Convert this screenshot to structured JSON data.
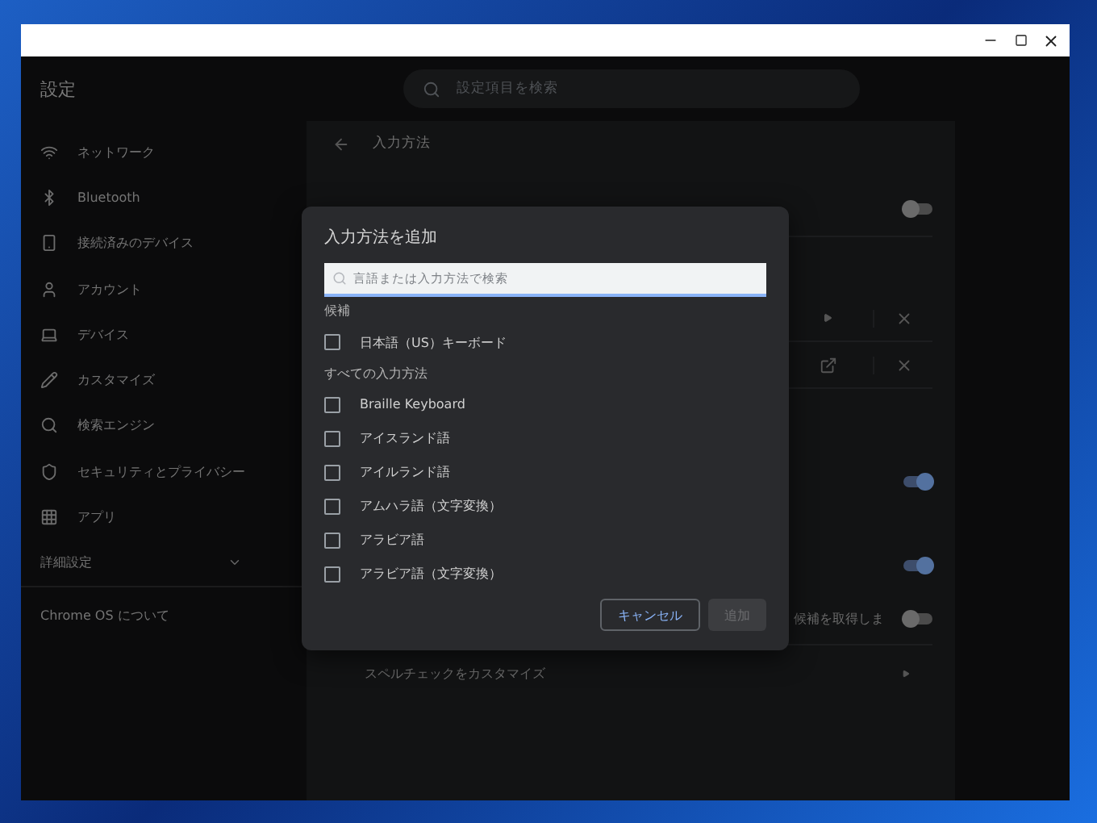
{
  "app": {
    "title": "設定",
    "search": {
      "placeholder": "設定項目を検索"
    }
  },
  "sidebar": {
    "items": [
      {
        "label": "ネットワーク"
      },
      {
        "label": "Bluetooth"
      },
      {
        "label": "接続済みのデバイス"
      },
      {
        "label": "アカウント"
      },
      {
        "label": "デバイス"
      },
      {
        "label": "カスタマイズ"
      },
      {
        "label": "検索エンジン"
      },
      {
        "label": "セキュリティとプライバシー"
      },
      {
        "label": "アプリ"
      }
    ],
    "advanced": {
      "label": "詳細設定",
      "expanded": false
    },
    "about": "Chrome OS について"
  },
  "page": {
    "title": "入力方法",
    "rows": [
      {
        "kind": "toggle",
        "on": false
      },
      {
        "kind": "language-chevron"
      },
      {
        "kind": "language-external"
      },
      {
        "kind": "toggle",
        "on": true
      },
      {
        "kind": "toggle",
        "on": true
      },
      {
        "kind": "toggle",
        "on": false,
        "label": "候補を取得しま"
      },
      {
        "kind": "link",
        "label": "スペルチェックをカスタマイズ"
      }
    ]
  },
  "dialog": {
    "title": "入力方法を追加",
    "search": {
      "placeholder": "言語または入力方法で検索"
    },
    "sections": [
      {
        "title": "候補",
        "items": [
          {
            "label": "日本語（US）キーボード",
            "checked": false
          }
        ]
      },
      {
        "title": "すべての入力方法",
        "items": [
          {
            "label": "Braille Keyboard",
            "checked": false
          },
          {
            "label": "アイスランド語",
            "checked": false
          },
          {
            "label": "アイルランド語",
            "checked": false
          },
          {
            "label": "アムハラ語（文字変換）",
            "checked": false
          },
          {
            "label": "アラビア語",
            "checked": false
          },
          {
            "label": "アラビア語（文字変換）",
            "checked": false
          }
        ]
      }
    ],
    "buttons": [
      {
        "label": "キャンセル",
        "kind": "secondary",
        "disabled": false
      },
      {
        "label": "追加",
        "kind": "primary",
        "disabled": true
      }
    ]
  }
}
